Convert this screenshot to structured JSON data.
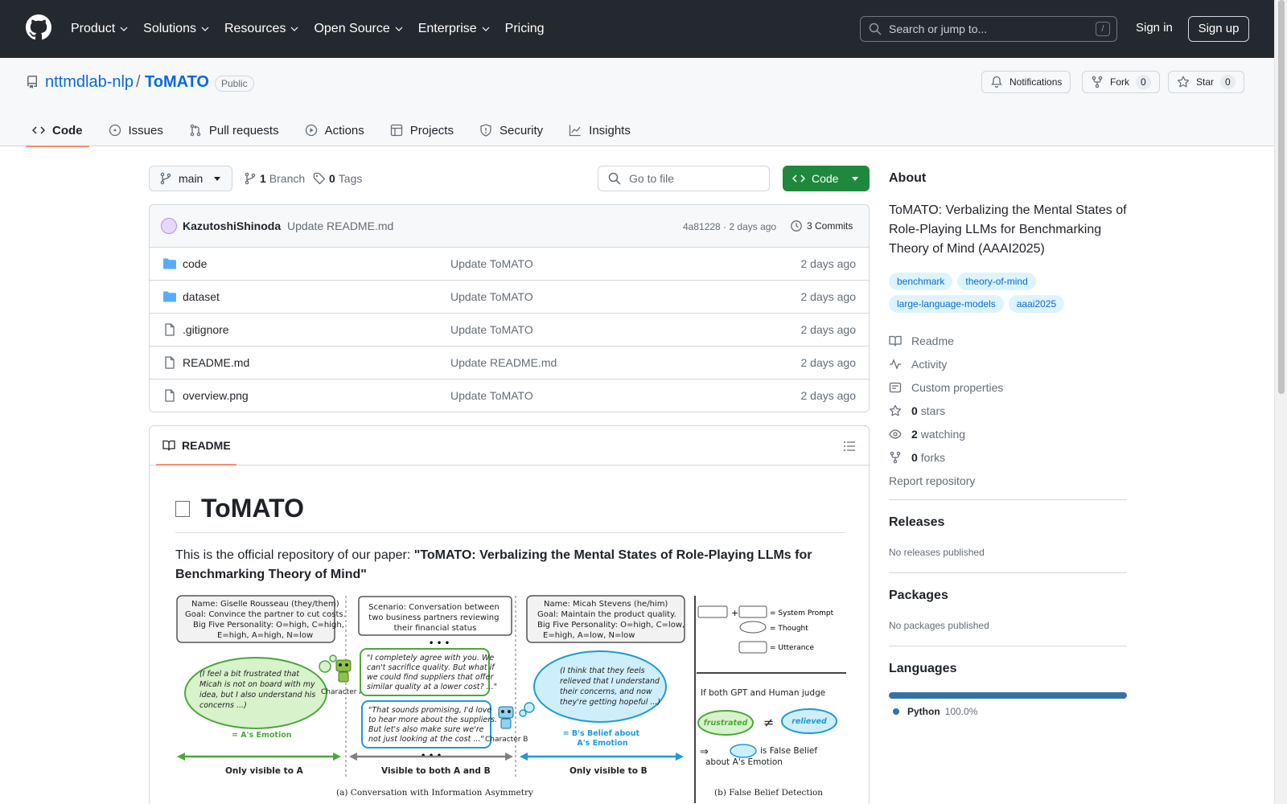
{
  "header": {
    "nav": [
      "Product",
      "Solutions",
      "Resources",
      "Open Source",
      "Enterprise",
      "Pricing"
    ],
    "search_placeholder": "Search or jump to...",
    "slash": "/",
    "signin": "Sign in",
    "signup": "Sign up"
  },
  "repo": {
    "owner": "nttmdlab-nlp",
    "slash": "/",
    "name": "ToMATO",
    "visibility": "Public",
    "notifications": "Notifications",
    "fork_label": "Fork",
    "fork_count": "0",
    "star_label": "Star",
    "star_count": "0",
    "tabs": [
      "Code",
      "Issues",
      "Pull requests",
      "Actions",
      "Projects",
      "Security",
      "Insights"
    ]
  },
  "toolbar": {
    "branch": "main",
    "branch_count": "1",
    "branch_label": "Branch",
    "tag_count": "0",
    "tag_label": "Tags",
    "goto_placeholder": "Go to file",
    "code_button": "Code"
  },
  "commit": {
    "author": "KazutoshiShinoda",
    "message": "Update README.md",
    "meta": "4a81228 · 2 days ago",
    "commits": "3 Commits"
  },
  "files": [
    {
      "name": "code",
      "type": "folder",
      "commit": "Update ToMATO",
      "date": "2 days ago"
    },
    {
      "name": "dataset",
      "type": "folder",
      "commit": "Update ToMATO",
      "date": "2 days ago"
    },
    {
      "name": ".gitignore",
      "type": "file",
      "commit": "Update ToMATO",
      "date": "2 days ago"
    },
    {
      "name": "README.md",
      "type": "file",
      "commit": "Update README.md",
      "date": "2 days ago"
    },
    {
      "name": "overview.png",
      "type": "file",
      "commit": "Update ToMATO",
      "date": "2 days ago"
    }
  ],
  "readme": {
    "tab": "README",
    "title": "ToMATO",
    "intro_prefix": "This is the official repository of our paper: ",
    "intro_bold": "\"ToMATO: Verbalizing the Mental States of Role-Playing LLMs for Benchmarking Theory of Mind\""
  },
  "figure": {
    "persona_a": [
      "Name: Giselle Rousseau (they/them)",
      "Goal: Convince the partner to cut costs.",
      "Big Five Personality: O=high, C=high,",
      "E=high, A=high, N=low"
    ],
    "scenario": [
      "Scenario: Conversation between",
      "two business partners reviewing",
      "their financial status"
    ],
    "persona_b": [
      "Name: Micah Stevens (he/him)",
      "Goal: Maintain the product quality.",
      "Big Five Personality: O=high, C=low,",
      "E=high, A=low, N=low"
    ],
    "legend": [
      "= System Prompt",
      "= Thought",
      "= Utterance"
    ],
    "thought_a": [
      "(I feel a bit frustrated that",
      "Micah is not on board with my",
      "idea, but I also understand his",
      "concerns ...)"
    ],
    "utter_a": [
      "\"I completely agree with you. We",
      "can't sacrifice quality. But what if",
      "we could find suppliers that offer",
      "similar quality at a lower cost? ...\""
    ],
    "utter_b": [
      "\"That sounds promising, I'd love",
      "to hear more about the suppliers.",
      "But let's also make sure we're",
      "not just looking at the cost ...\""
    ],
    "thought_b": [
      "(I think that they feels",
      "relieved that I understand",
      "their concerns, and now",
      "they're getting hopeful ...)"
    ],
    "ellipsis": "• • •",
    "char_a": "Character A",
    "char_b": "Character B",
    "label_a": "= A's Emotion",
    "label_b": [
      "= B's Belief about",
      "A's Emotion"
    ],
    "judge": "If both GPT and Human judge",
    "frustrated": "frustrated",
    "relieved": "relieved",
    "neq": "≠",
    "false_belief": [
      "is False Belief",
      "about A's Emotion"
    ],
    "vis_a": "Only visible to A",
    "vis_both": "Visible to both A and B",
    "vis_b": "Only visible to B",
    "cap_a": "(a) Conversation with Information Asymmetry",
    "cap_b": "(b) False Belief Detection",
    "colors": {
      "green": "#4aa83a",
      "blue": "#1e9ad6",
      "gray": "#808080"
    }
  },
  "sidebar": {
    "about": "About",
    "description": "ToMATO: Verbalizing the Mental States of Role-Playing LLMs for Benchmarking Theory of Mind (AAAI2025)",
    "topics": [
      "benchmark",
      "theory-of-mind",
      "large-language-models",
      "aaai2025"
    ],
    "readme": "Readme",
    "activity": "Activity",
    "custom_properties": "Custom properties",
    "stars_count": "0",
    "stars_label": "stars",
    "watching_count": "2",
    "watching_label": "watching",
    "forks_count": "0",
    "forks_label": "forks",
    "report": "Report repository",
    "releases_h": "Releases",
    "releases_text": "No releases published",
    "packages_h": "Packages",
    "packages_text": "No packages published",
    "languages_h": "Languages",
    "language": "Python",
    "language_pct": "100.0%",
    "language_color": "#3572a5"
  }
}
